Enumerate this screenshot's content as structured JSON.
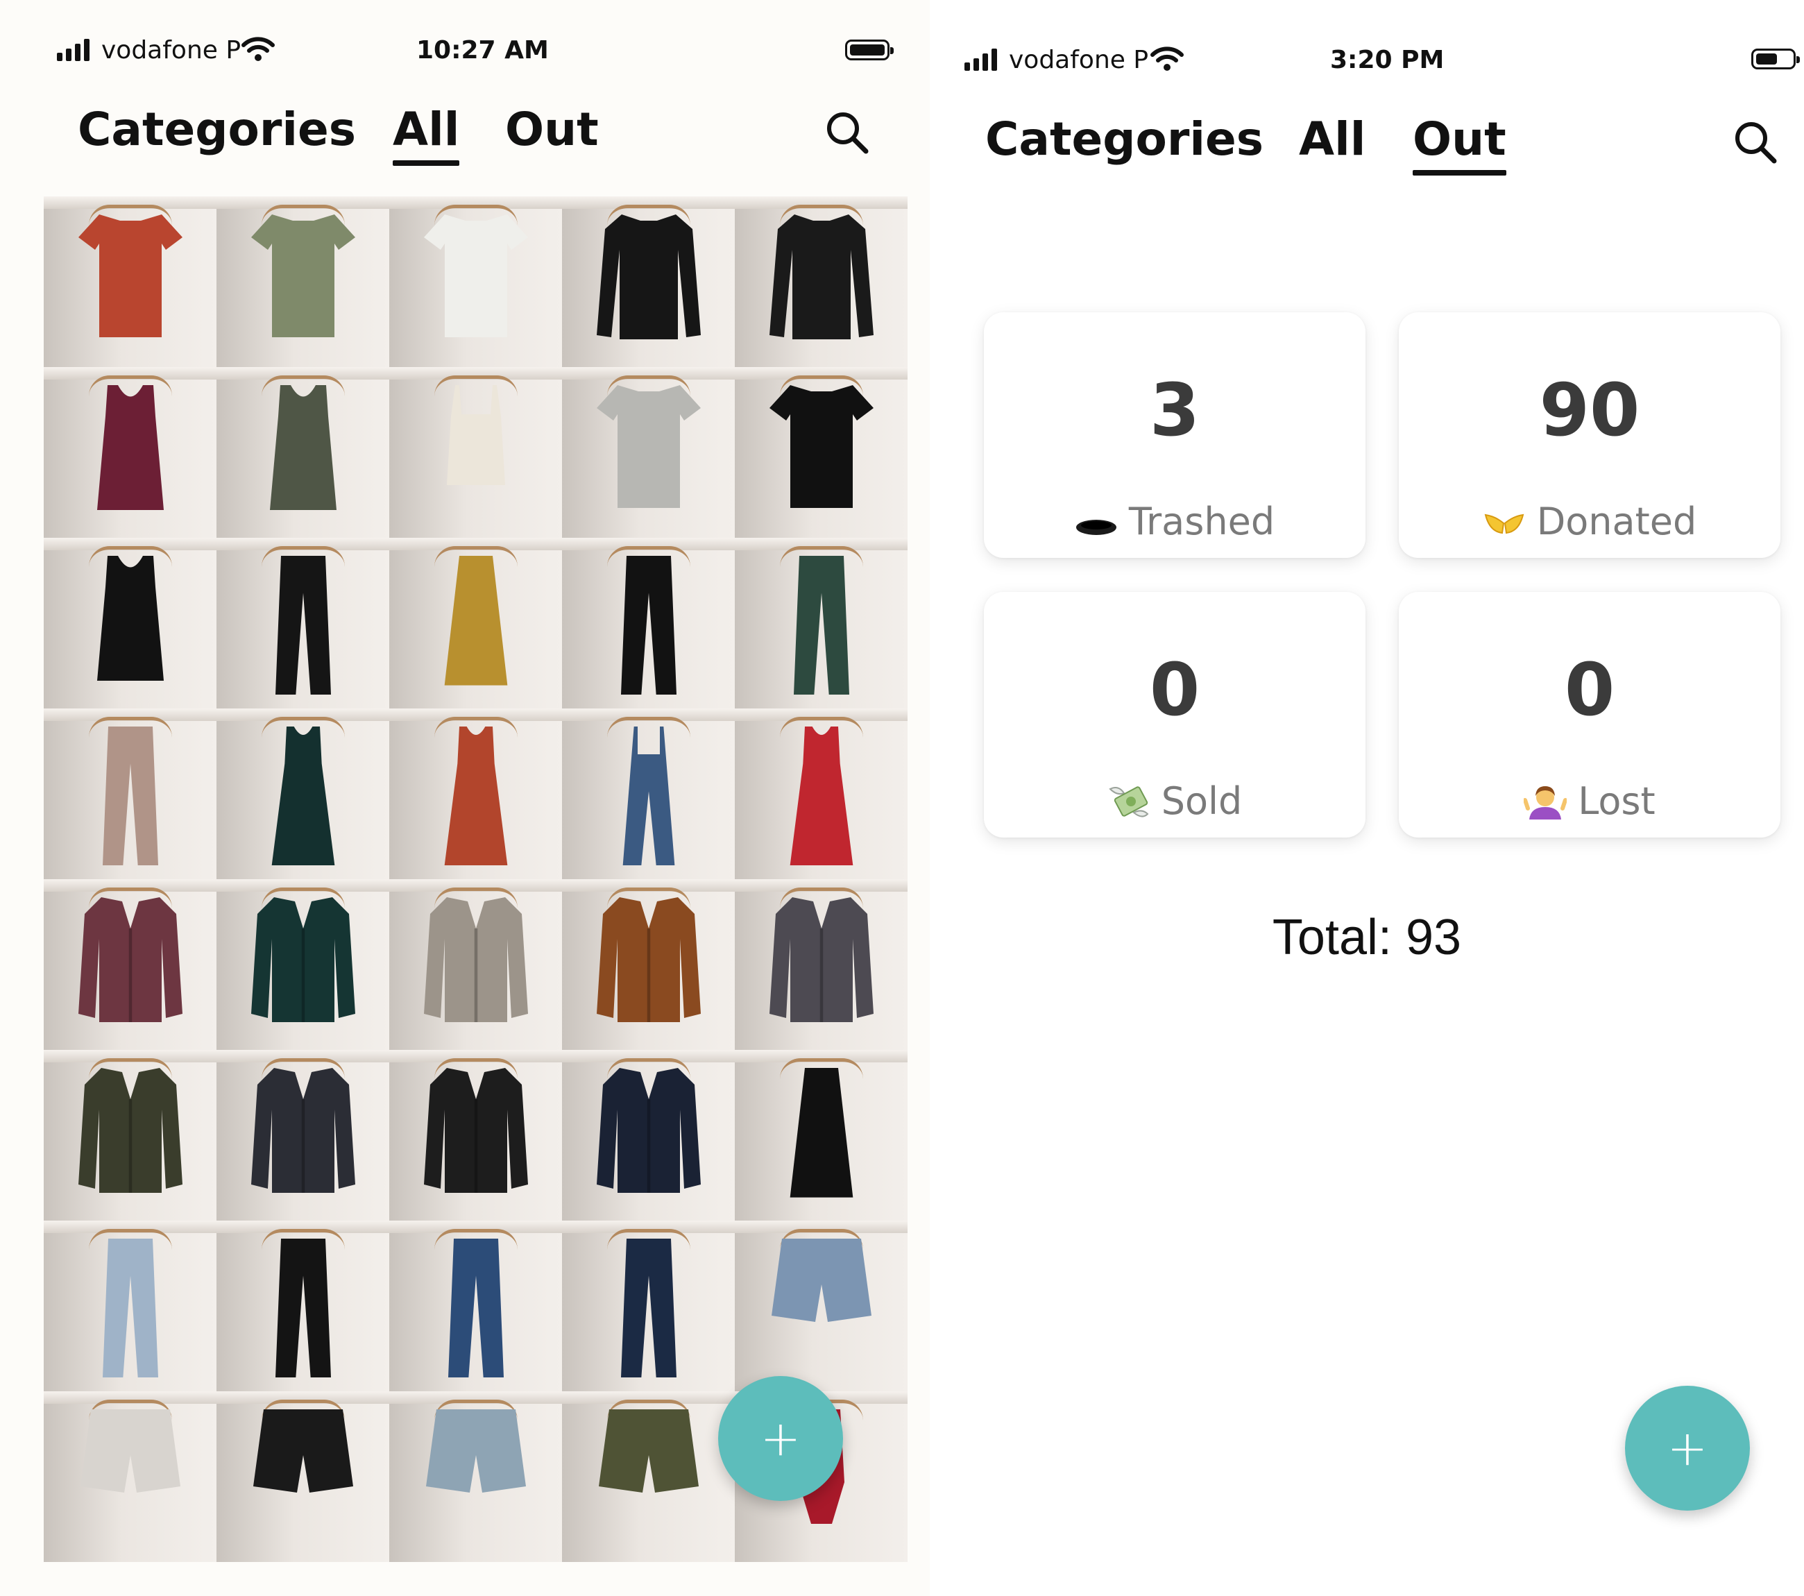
{
  "left_screen": {
    "status": {
      "carrier": "vodafone P",
      "time": "10:27 AM"
    },
    "nav": {
      "tabs": [
        {
          "label": "Categories",
          "active": false
        },
        {
          "label": "All",
          "active": true
        },
        {
          "label": "Out",
          "active": false
        }
      ],
      "search_icon": "search-icon"
    },
    "grid": {
      "columns": 5,
      "items": [
        {
          "kind": "tshirt",
          "color": "#b9452f"
        },
        {
          "kind": "tshirt",
          "color": "#7f8a6a"
        },
        {
          "kind": "tshirt",
          "color": "#efefeb"
        },
        {
          "kind": "longsleeve",
          "color": "#161616"
        },
        {
          "kind": "longsleeve",
          "color": "#1a1a1a"
        },
        {
          "kind": "tank",
          "color": "#6c1f35"
        },
        {
          "kind": "tank",
          "color": "#4f5646"
        },
        {
          "kind": "cami",
          "color": "#ece6da"
        },
        {
          "kind": "tshirt",
          "color": "#b7b7b3"
        },
        {
          "kind": "tshirt",
          "color": "#111111"
        },
        {
          "kind": "tank",
          "color": "#121212"
        },
        {
          "kind": "pants",
          "color": "#151515"
        },
        {
          "kind": "skirt",
          "color": "#b8902f"
        },
        {
          "kind": "pants",
          "color": "#121212"
        },
        {
          "kind": "pants",
          "color": "#2d4a3f"
        },
        {
          "kind": "pants",
          "color": "#b09488"
        },
        {
          "kind": "dress",
          "color": "#14302f"
        },
        {
          "kind": "dress",
          "color": "#b2452c"
        },
        {
          "kind": "overalls",
          "color": "#3b5a82"
        },
        {
          "kind": "dress",
          "color": "#c0262f"
        },
        {
          "kind": "jacket",
          "color": "#6d3641"
        },
        {
          "kind": "jacket",
          "color": "#153533"
        },
        {
          "kind": "jacket",
          "color": "#9c948a"
        },
        {
          "kind": "jacket",
          "color": "#8a4a20"
        },
        {
          "kind": "jacket",
          "color": "#4d4a52"
        },
        {
          "kind": "jacket",
          "color": "#3a3d2c"
        },
        {
          "kind": "jacket",
          "color": "#2b2d35"
        },
        {
          "kind": "jacket",
          "color": "#1d1d1d"
        },
        {
          "kind": "jacket",
          "color": "#1a2234"
        },
        {
          "kind": "skirt",
          "color": "#111111"
        },
        {
          "kind": "pants",
          "color": "#9fb3c8"
        },
        {
          "kind": "pants",
          "color": "#141414"
        },
        {
          "kind": "pants",
          "color": "#2c4c78"
        },
        {
          "kind": "pants",
          "color": "#1b2a44"
        },
        {
          "kind": "shorts",
          "color": "#7c95b2"
        },
        {
          "kind": "shorts",
          "color": "#d8d4cf"
        },
        {
          "kind": "shorts",
          "color": "#1a1a1a"
        },
        {
          "kind": "shorts",
          "color": "#8ea4b4"
        },
        {
          "kind": "shorts",
          "color": "#4f5335"
        },
        {
          "kind": "bodysuit",
          "color": "#a8192a"
        }
      ]
    },
    "fab": {
      "label": "+"
    }
  },
  "right_screen": {
    "status": {
      "carrier": "vodafone P",
      "time": "3:20 PM"
    },
    "nav": {
      "tabs": [
        {
          "label": "Categories",
          "active": false
        },
        {
          "label": "All",
          "active": false
        },
        {
          "label": "Out",
          "active": true
        }
      ],
      "search_icon": "search-icon"
    },
    "stats": [
      {
        "count": "3",
        "label": "Trashed",
        "icon": "hole-emoji"
      },
      {
        "count": "90",
        "label": "Donated",
        "icon": "open-hands-emoji"
      },
      {
        "count": "0",
        "label": "Sold",
        "icon": "money-with-wings-emoji"
      },
      {
        "count": "0",
        "label": "Lost",
        "icon": "person-shrugging-emoji"
      }
    ],
    "total": "Total: 93",
    "fab": {
      "label": "+"
    }
  },
  "colors": {
    "accent": "#5dbdbb",
    "count_text": "#3b3b3b",
    "label_text": "#7a7a7a"
  }
}
